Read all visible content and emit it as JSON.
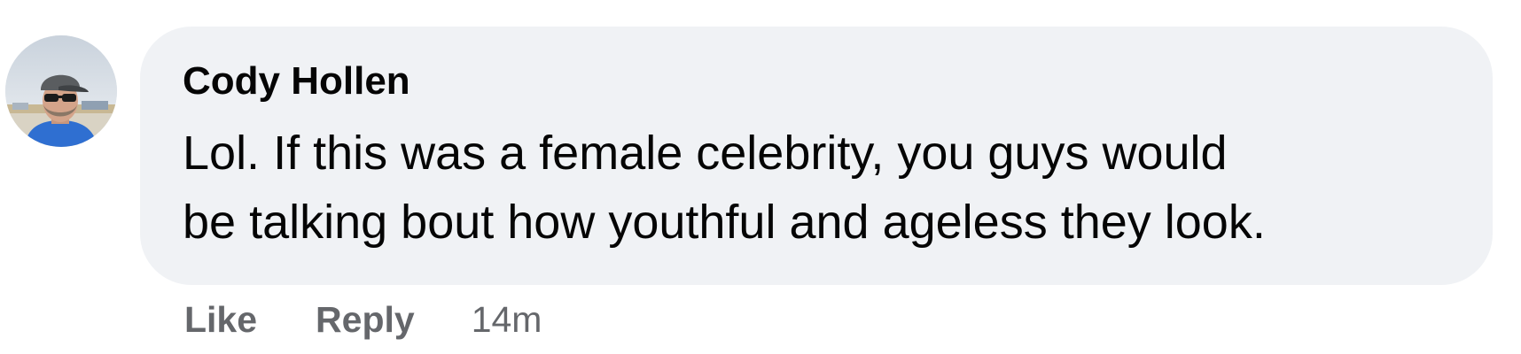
{
  "comment": {
    "author": "Cody Hollen",
    "text_lines": [
      "Lol. If this was a female celebrity, you guys would",
      "be talking bout how youthful and ageless they look."
    ]
  },
  "actions": {
    "like_label": "Like",
    "reply_label": "Reply",
    "timestamp": "14m"
  },
  "colors": {
    "bubble_background": "#f0f2f5",
    "text": "#050505",
    "secondary_text": "#65676b"
  },
  "icons": {
    "avatar": "user-profile-photo"
  }
}
